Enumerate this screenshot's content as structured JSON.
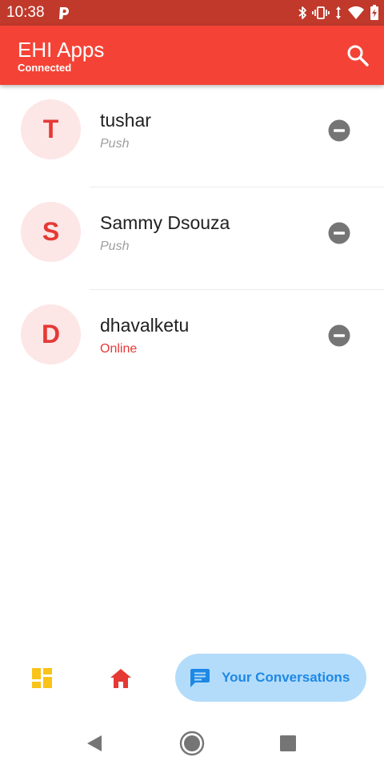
{
  "status_bar": {
    "time": "10:38",
    "icons": [
      "p-app-icon",
      "bluetooth-icon",
      "vibrate-icon",
      "data-arrows-icon",
      "wifi-icon",
      "battery-charging-icon"
    ]
  },
  "app_bar": {
    "title": "EHI Apps",
    "subtitle": "Connected",
    "search_icon": "search-icon"
  },
  "contacts": [
    {
      "initial": "T",
      "name": "tushar",
      "status": "Push"
    },
    {
      "initial": "S",
      "name": "Sammy Dsouza",
      "status": "Push"
    },
    {
      "initial": "D",
      "name": "dhavalketu",
      "status": "Online"
    }
  ],
  "bottom_nav": {
    "dashboard_icon": "dashboard-icon",
    "home_icon": "home-icon",
    "conversations_label": "Your Conversations"
  },
  "colors": {
    "status_bar": "#c0392b",
    "app_bar": "#f44336",
    "avatar_bg": "#fde6e6",
    "avatar_text": "#e53935",
    "online": "#e53935",
    "muted": "#9e9e9e",
    "dashboard": "#f9c31a",
    "conversation_pill": "#b3dcfb",
    "conversation_text": "#1e88e5"
  }
}
